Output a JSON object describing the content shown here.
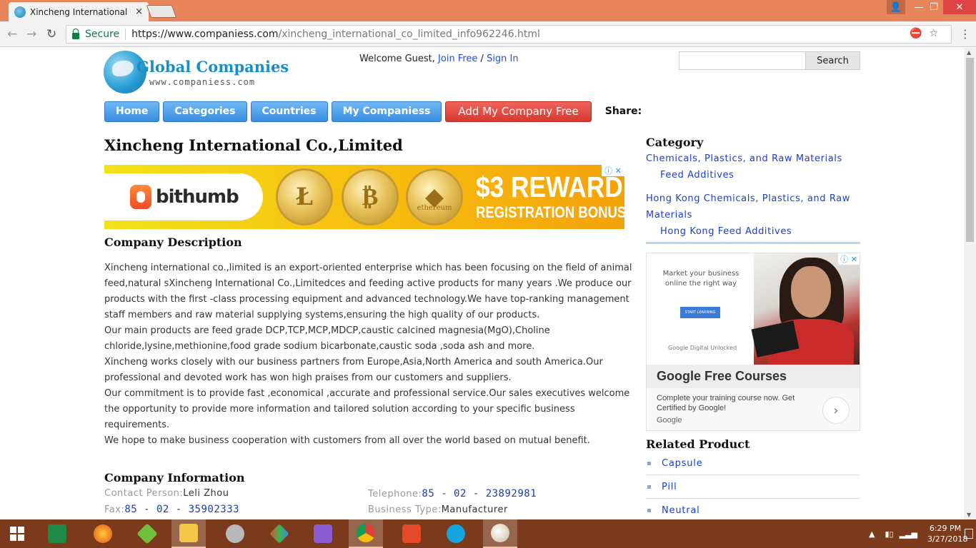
{
  "browser": {
    "tab_title": "Xincheng International C",
    "tab_close": "×",
    "secure_label": "Secure",
    "url_host": "https://www.companiess.com",
    "url_path": "/xincheng_international_co_limited_info962246.html"
  },
  "site": {
    "logo_title": "Global Companies",
    "logo_sub": "www.companiess.com",
    "welcome_text": "Welcome Guest, ",
    "join_link": "Join Free",
    "slash": " / ",
    "signin_link": "Sign In",
    "search_placeholder": "",
    "search_button": "Search",
    "nav": {
      "home": "Home",
      "categories": "Categories",
      "countries": "Countries",
      "my_companies": "My Companiess",
      "add_company": "Add My Company Free",
      "share": "Share:"
    }
  },
  "company": {
    "title": "Xincheng International Co.,Limited",
    "desc_heading": "Company Description",
    "description": [
      "Xincheng international co.,limited is an export-oriented enterprise which has been focusing on the field of animal feed,natural sXincheng International Co.,Limitedces and feeding active products for many years .We produce our products with the first -class processing equipment and advanced technology.We have top-ranking management staff members and raw material supplying systems,ensuring the high quality of our products.",
      "Our main products are feed grade DCP,TCP,MCP,MDCP,caustic calcined magnesia(MgO),Choline chloride,lysine,methionine,food grade sodium bicarbonate,caustic soda ,soda ash and more.",
      "Xincheng works closely with our business partners from Europe,Asia,North America and south America.Our professional and devoted work has won high praises from our customers and suppliers.",
      "Our commitment is to provide fast ,economical ,accurate and professional service.Our sales executives welcome the opportunity to provide more information and tailored solution according to your specific business requirements.",
      "We hope to make business cooperation with customers from all over the world based on mutual benefit."
    ],
    "info_heading": "Company Information",
    "contact_label": "Contact Person:",
    "contact_value": "Leli Zhou",
    "telephone_label": "Telephone:",
    "telephone_value": "85 - 02 - 23892981",
    "fax_label": "Fax:",
    "fax_value": "85 - 02 - 35902333",
    "business_type_label": "Business Type:",
    "business_type_value": "Manufacturer"
  },
  "ad_banner": {
    "brand": "bithumb",
    "coin1": "Ł",
    "coin2": "₿",
    "coin3_symbol": "◆",
    "coin3_label": "ethereum",
    "headline": "$3 REWARD",
    "sub": "REGISTRATION BONUS",
    "adchoice": "ⓘ ✕"
  },
  "sidebar": {
    "category_heading": "Category",
    "cat1": "Chemicals, Plastics, and Raw Materials",
    "cat1_sub": "Feed Additives",
    "cat2": "Hong Kong Chemicals, Plastics, and Raw Materials",
    "cat2_sub": "Hong Kong Feed Additives",
    "ad": {
      "copy": "Market your business online the right way",
      "button": "START LEARNING",
      "brand": "Google Digital Unlocked",
      "title": "Google Free Courses",
      "body": "Complete your training course now. Get Certified by Google!",
      "footer": "Google",
      "arrow": "›",
      "adchoice": "ⓘ ✕"
    },
    "related_heading": "Related Product",
    "products": [
      "Capsule",
      "Pill",
      "Neutral"
    ]
  },
  "taskbar": {
    "time": "6:29 PM",
    "date": "3/27/2018"
  },
  "colors": {
    "titlebar": "#e8855a",
    "nav_blue": "#3a8de0",
    "nav_red": "#d63a30",
    "link_blue": "#1a3fd0",
    "taskbar": "#7c3a1c"
  }
}
